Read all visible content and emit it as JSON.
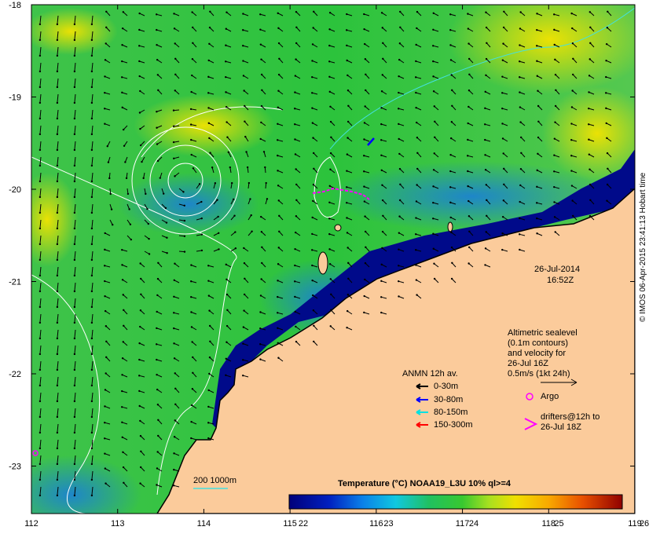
{
  "colors": {
    "land": "#fbcb9b",
    "deep": "#000080",
    "warm": "#f5d800",
    "mid": "#22c23a",
    "cool": "#0aa0e8"
  },
  "axes": {
    "x_ticks": [
      "112",
      "113",
      "114",
      "115",
      "116",
      "117",
      "118",
      "119"
    ],
    "y_ticks": [
      "-18",
      "-19",
      "-20",
      "-21",
      "-22",
      "-23"
    ]
  },
  "timestamp": {
    "date": "26-Jul-2014",
    "time": "16:52Z"
  },
  "altimetry": {
    "line1": "Altimetric sealevel",
    "line2": "(0.1m contours)",
    "line3": "and velocity for",
    "line4": "26-Jul 16Z",
    "line5": "0.5m/s (1kt 24h)"
  },
  "anmn": {
    "title": "ANMN 12h av.",
    "items": [
      {
        "label": "0-30m",
        "color": "#000000"
      },
      {
        "label": "30-80m",
        "color": "#0000ff"
      },
      {
        "label": "80-150m",
        "color": "#00e0e0"
      },
      {
        "label": "150-300m",
        "color": "#ff0000"
      }
    ]
  },
  "argo": {
    "label": "Argo",
    "color": "#ff00ff"
  },
  "drifters": {
    "line1": "drifters@12h to",
    "line2": "26-Jul 18Z"
  },
  "bathy": {
    "label": "200  1000m"
  },
  "colorbar": {
    "title": "Temperature (°C) NOAA19_L3U 10% ql>=4",
    "ticks": [
      "22",
      "23",
      "24",
      "25",
      "26"
    ]
  },
  "credit": "© IMOS 06-Apr-2015 23:41:13 Hobart time"
}
